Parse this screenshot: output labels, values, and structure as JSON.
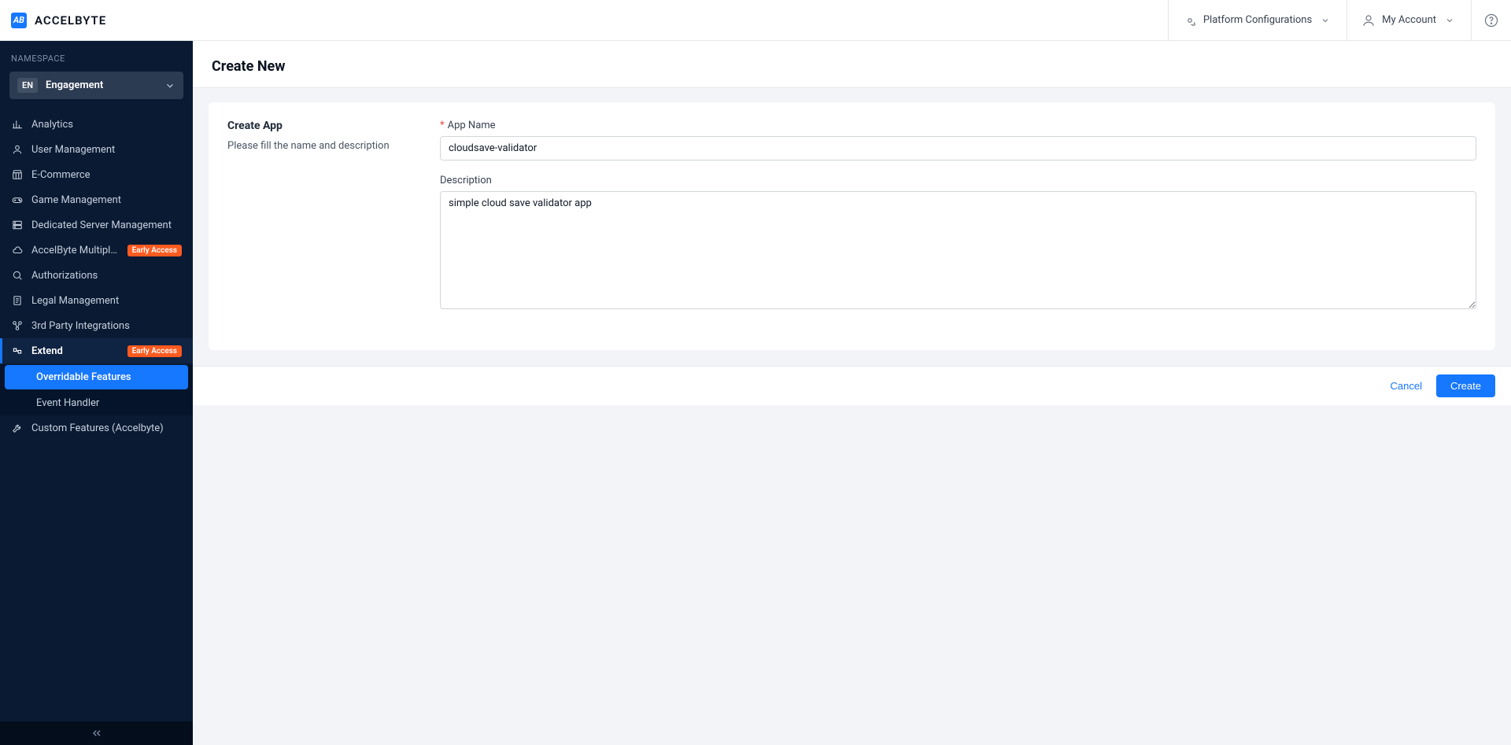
{
  "brand": {
    "logo_initials": "AB",
    "name": "ACCELBYTE"
  },
  "header": {
    "platform_config_label": "Platform Configurations",
    "account_label": "My Account"
  },
  "sidebar": {
    "namespace_label": "NAMESPACE",
    "namespace_chip": "EN",
    "namespace_name": "Engagement",
    "items": [
      {
        "icon": "analytics-icon",
        "label": "Analytics"
      },
      {
        "icon": "user-icon",
        "label": "User Management"
      },
      {
        "icon": "store-icon",
        "label": "E-Commerce"
      },
      {
        "icon": "game-icon",
        "label": "Game Management"
      },
      {
        "icon": "server-icon",
        "label": "Dedicated Server Management"
      },
      {
        "icon": "cloud-icon",
        "label": "AccelByte Multiplaye...",
        "badge": "Early Access"
      },
      {
        "icon": "key-icon",
        "label": "Authorizations"
      },
      {
        "icon": "legal-icon",
        "label": "Legal Management"
      },
      {
        "icon": "integrations-icon",
        "label": "3rd Party Integrations"
      },
      {
        "icon": "extend-icon",
        "label": "Extend",
        "badge": "Early Access",
        "expanded": true,
        "children": [
          {
            "label": "Overridable Features",
            "active": true
          },
          {
            "label": "Event Handler"
          }
        ]
      },
      {
        "icon": "wrench-icon",
        "label": "Custom Features (Accelbyte)"
      }
    ]
  },
  "page": {
    "title": "Create New",
    "section_title": "Create App",
    "section_help": "Please fill the name and description",
    "app_name_label": "App Name",
    "app_name_value": "cloudsave-validator",
    "description_label": "Description",
    "description_value": "simple cloud save validator app",
    "cancel_label": "Cancel",
    "create_label": "Create"
  }
}
